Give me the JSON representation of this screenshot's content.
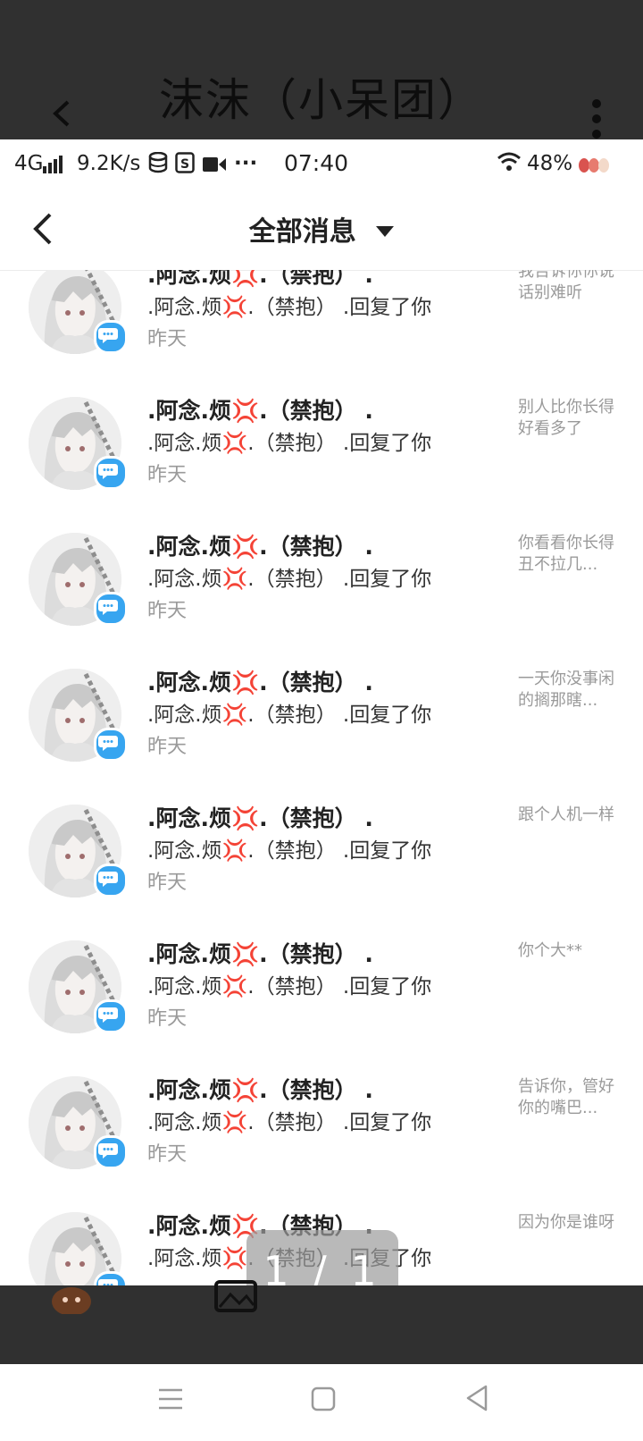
{
  "viewer": {
    "title": "沫沫（小呆团）",
    "page_counter": "1 / 1"
  },
  "status_bar": {
    "network": "4G",
    "speed": "9.2K/s",
    "dots": "···",
    "time": "07:40",
    "battery": "48%"
  },
  "header": {
    "title": "全部消息",
    "dropdown_icon": "caret-down-icon"
  },
  "messages": [
    {
      "name": ".阿念.烦💢.（禁抱） .",
      "line": ".阿念.烦💢.（禁抱）  .回复了你",
      "time": "昨天",
      "preview": "我告诉你你说话别难听"
    },
    {
      "name": ".阿念.烦💢.（禁抱） .",
      "line": ".阿念.烦💢.（禁抱）  .回复了你",
      "time": "昨天",
      "preview": "别人比你长得好看多了"
    },
    {
      "name": ".阿念.烦💢.（禁抱） .",
      "line": ".阿念.烦💢.（禁抱）  .回复了你",
      "time": "昨天",
      "preview": "你看看你长得丑不拉几..."
    },
    {
      "name": ".阿念.烦💢.（禁抱） .",
      "line": ".阿念.烦💢.（禁抱）  .回复了你",
      "time": "昨天",
      "preview": "一天你没事闲的搁那瞎..."
    },
    {
      "name": ".阿念.烦💢.（禁抱） .",
      "line": ".阿念.烦💢.（禁抱）  .回复了你",
      "time": "昨天",
      "preview": "跟个人机一样"
    },
    {
      "name": ".阿念.烦💢.（禁抱） .",
      "line": ".阿念.烦💢.（禁抱）  .回复了你",
      "time": "昨天",
      "preview": "你个大**"
    },
    {
      "name": ".阿念.烦💢.（禁抱） .",
      "line": ".阿念.烦💢.（禁抱）  .回复了你",
      "time": "昨天",
      "preview": "告诉你，管好你的嘴巴..."
    },
    {
      "name": ".阿念.烦💢.（禁抱） .",
      "line": ".阿念.烦💢.（禁抱）  .回复了你",
      "time": "",
      "preview": "因为你是谁呀"
    }
  ],
  "colors": {
    "accent": "#37a5f0",
    "viewer_bg": "#303030",
    "secondary_text": "#9a9a9a"
  }
}
